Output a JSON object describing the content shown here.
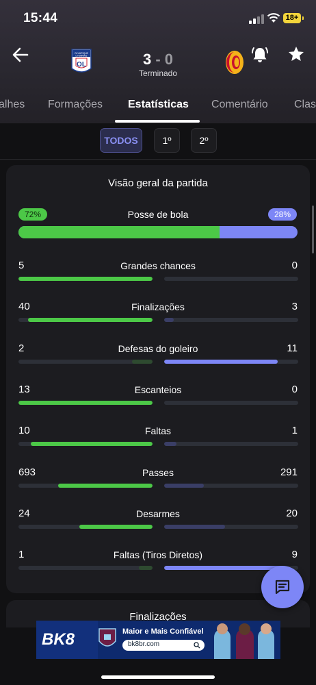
{
  "status_bar": {
    "time": "15:44",
    "battery": "18+"
  },
  "match": {
    "home_score": "3",
    "separator": "-",
    "away_score": "0",
    "status": "Terminado",
    "home_crest": "OL",
    "home_crest_text": "OLYMPIQUE LYONNAIS"
  },
  "tabs": [
    "alhes",
    "Formações",
    "Estatísticas",
    "Comentário",
    "Clas"
  ],
  "active_tab": "Estatísticas",
  "periods": {
    "all": "TODOS",
    "first": "1º",
    "second": "2º"
  },
  "overview": {
    "title": "Visão geral da partida",
    "possession": {
      "label": "Posse de bola",
      "home": "72%",
      "away": "28%",
      "home_value": 72,
      "away_value": 28
    },
    "stats": [
      {
        "label": "Grandes chances",
        "home": "5",
        "away": "0",
        "home_val": 5,
        "away_val": 0
      },
      {
        "label": "Finalizações",
        "home": "40",
        "away": "3",
        "home_val": 40,
        "away_val": 3
      },
      {
        "label": "Defesas do goleiro",
        "home": "2",
        "away": "11",
        "home_val": 2,
        "away_val": 11
      },
      {
        "label": "Escanteios",
        "home": "13",
        "away": "0",
        "home_val": 13,
        "away_val": 0
      },
      {
        "label": "Faltas",
        "home": "10",
        "away": "1",
        "home_val": 10,
        "away_val": 1
      },
      {
        "label": "Passes",
        "home": "693",
        "away": "291",
        "home_val": 693,
        "away_val": 291
      },
      {
        "label": "Desarmes",
        "home": "24",
        "away": "20",
        "home_val": 24,
        "away_val": 20
      },
      {
        "label": "Faltas (Tiros Diretos)",
        "home": "1",
        "away": "9",
        "home_val": 1,
        "away_val": 9
      }
    ]
  },
  "next_section_title": "Finalizações",
  "ad": {
    "brand": "BK8",
    "tagline": "Maior e Mais Confiável",
    "url": "bk8br.com"
  },
  "colors": {
    "home": "#4cc847",
    "away": "#7d86f6",
    "home_dim": "#2e4a30",
    "away_dim": "#3a3e66",
    "track": "#2d3038"
  }
}
